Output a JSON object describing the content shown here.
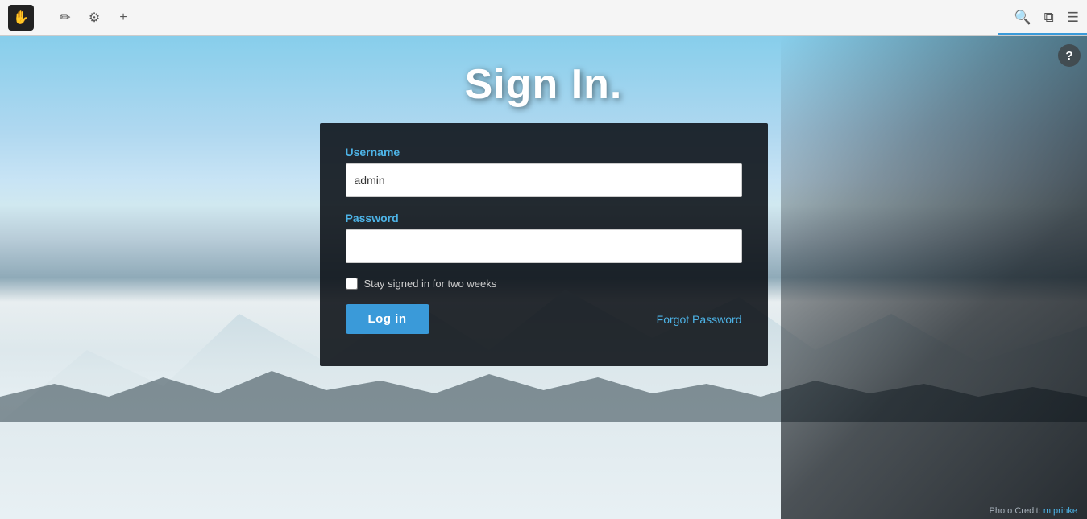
{
  "browser": {
    "icons": {
      "hand": "✋",
      "pencil": "✏",
      "gear": "⚙",
      "plus": "+",
      "search": "🔍",
      "copy": "⧉",
      "settings": "☰"
    }
  },
  "page": {
    "title": "Sign In.",
    "help_symbol": "?",
    "photo_credit_label": "Photo Credit:",
    "photo_credit_author": "m prinke"
  },
  "form": {
    "username_label": "Username",
    "username_value": "admin",
    "username_placeholder": "",
    "password_label": "Password",
    "password_value": "",
    "password_placeholder": "",
    "stay_signed_label": "Stay signed in for two weeks",
    "login_button": "Log in",
    "forgot_password": "Forgot Password"
  }
}
